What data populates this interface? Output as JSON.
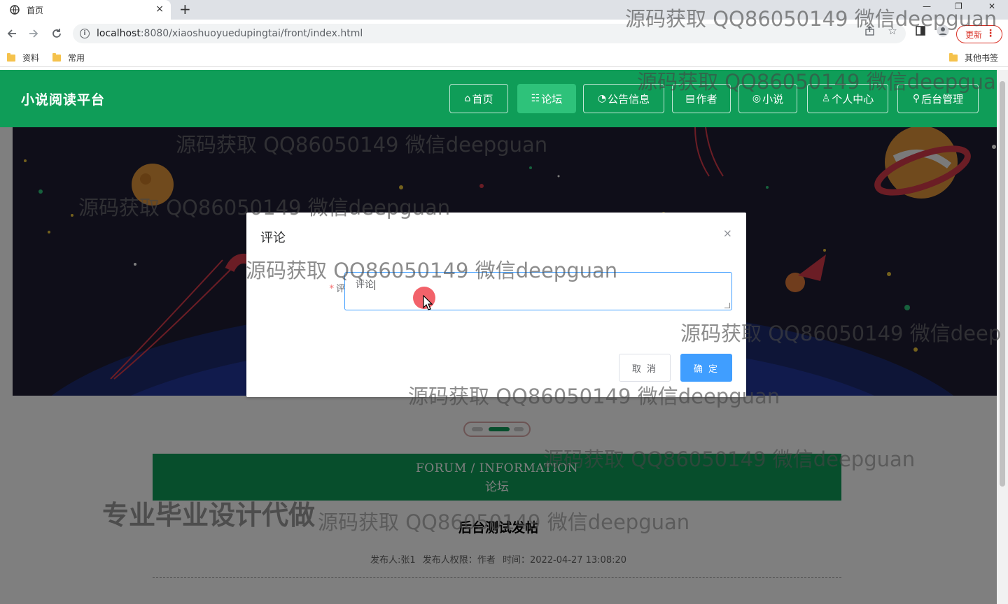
{
  "browser": {
    "tab_title": "首页",
    "tab_close": "×",
    "new_tab": "+",
    "window_controls": [
      "—",
      "❐",
      "✕"
    ],
    "url_host": "localhost",
    "url_rest": ":8080/xiaoshuoyuedupingtai/front/index.html",
    "update_label": "更新",
    "update_menu": "⋮",
    "bookmarks": [
      "资料",
      "常用"
    ],
    "other_bookmarks": "其他书签"
  },
  "site": {
    "brand": "小说阅读平台",
    "nav": [
      {
        "icon": "⌂",
        "label": "首页"
      },
      {
        "icon": "☷",
        "label": "论坛"
      },
      {
        "icon": "◔",
        "label": "公告信息"
      },
      {
        "icon": "▤",
        "label": "作者"
      },
      {
        "icon": "◎",
        "label": "小说"
      },
      {
        "icon": "♙",
        "label": "个人中心"
      },
      {
        "icon": "⚲",
        "label": "后台管理"
      }
    ],
    "active_nav_index": 1
  },
  "forum": {
    "heading_en": "FORUM / INFORMATION",
    "heading_cn": "论坛",
    "post_title": "后台测试发帖",
    "meta": [
      "发布人:张1",
      "发布人权限：作者",
      "时间：2022-04-27 13:08:20"
    ]
  },
  "dialog": {
    "title": "评论",
    "close": "×",
    "field_required": "*",
    "field_label": "评论内容",
    "field_value": "评论",
    "cancel_label": "取 消",
    "confirm_label": "确 定"
  },
  "watermarks": {
    "text": "源码获取 QQ86050149 微信deepguan",
    "text_cut1": "源码获取 QQ86050149 微信deepgua",
    "text_cut2": "源码获取 QQ86050149 微信deep",
    "text_cut3": "源码获取 QQ86050149 微信deepguan",
    "promo": "专业毕业设计代做"
  },
  "colors": {
    "brand_green": "#0f9d58",
    "active_green": "#2ec27a",
    "primary_blue": "#409eff",
    "banner_dark": "#1e1d32"
  }
}
